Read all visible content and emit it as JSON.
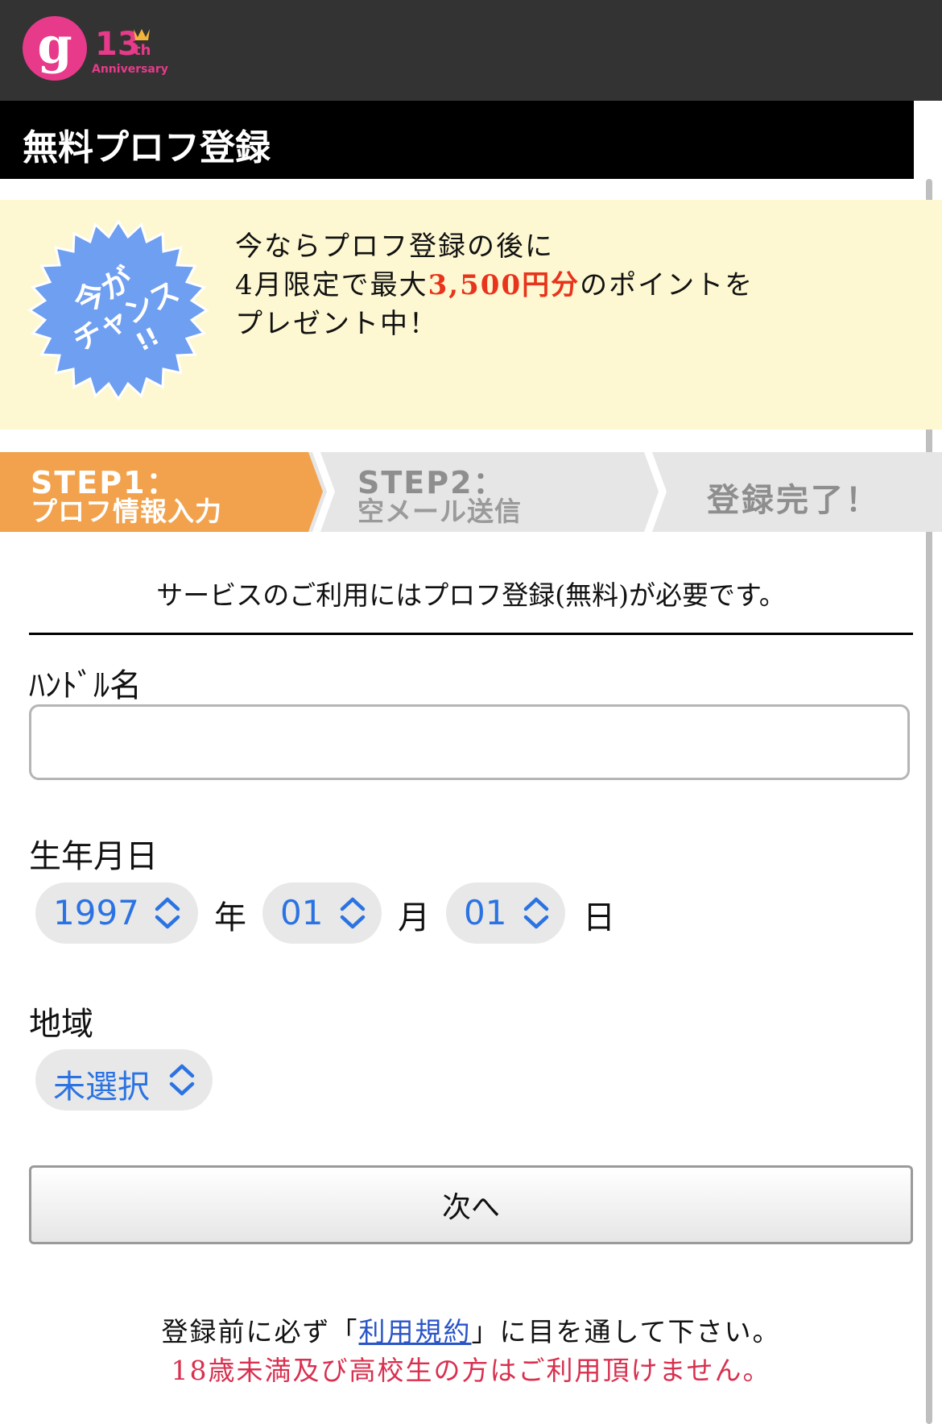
{
  "header": {
    "logo": {
      "letter": "g",
      "anniversary": "13",
      "anniversary_suffix": "th",
      "anniversary_label": "Anniversary"
    },
    "page_title": "無料プロフ登録"
  },
  "campaign": {
    "badge_line1": "今が",
    "badge_line2": "チャンス",
    "badge_line3": "!!",
    "line1": "今ならプロフ登録の後に",
    "line2_pre": "4月限定で最大",
    "line2_highlight": "3,500円分",
    "line2_post": "のポイントを",
    "line3": "プレゼント中！",
    "highlight_color": "#e8341c"
  },
  "steps": [
    {
      "title": "STEP1：",
      "subtitle": "プロフ情報入力",
      "active": true
    },
    {
      "title": "STEP2：",
      "subtitle": "空メール送信",
      "active": false
    },
    {
      "title": "登録完了！",
      "active": false
    }
  ],
  "notice": "サービスのご利用にはプロフ登録(無料)が必要です。",
  "form": {
    "handle": {
      "label": "ﾊﾝﾄﾞﾙ名",
      "value": "",
      "placeholder": ""
    },
    "birthdate": {
      "label": "生年月日",
      "year": "1997",
      "year_unit": "年",
      "month": "01",
      "month_unit": "月",
      "day": "01",
      "day_unit": "日"
    },
    "region": {
      "label": "地域",
      "value": "未選択"
    },
    "next_button": "次へ"
  },
  "footer": {
    "line1_pre": "登録前に必ず「",
    "terms_link": "利用規約",
    "line1_post": "」に目を通して下さい。",
    "line2": "18歳未満及び高校生の方はご利用頂けません。"
  },
  "colors": {
    "accent_orange": "#f2a24c",
    "select_blue": "#2b73e3",
    "warning_red": "#d8304f",
    "campaign_bg": "#fdf8d2"
  }
}
